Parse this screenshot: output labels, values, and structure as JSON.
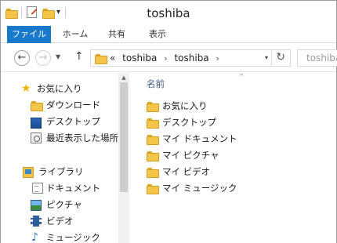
{
  "window": {
    "title": "toshiba"
  },
  "ribbon": {
    "tabs": [
      "ファイル",
      "ホーム",
      "共有",
      "表示"
    ]
  },
  "address": {
    "overflow": "«",
    "crumbs": [
      "toshiba",
      "toshiba"
    ]
  },
  "search": {
    "text": "toshiba"
  },
  "nav": {
    "favorites": {
      "label": "お気に入り",
      "items": [
        "ダウンロード",
        "デスクトップ",
        "最近表示した場所"
      ]
    },
    "libraries": {
      "label": "ライブラリ",
      "items": [
        "ドキュメント",
        "ピクチャ",
        "ビデオ",
        "ミュージック"
      ]
    }
  },
  "content": {
    "column_name": "名前",
    "items": [
      "お気に入り",
      "デスクトップ",
      "マイ ドキュメント",
      "マイ ピクチャ",
      "マイ ビデオ",
      "マイ ミュージック"
    ]
  },
  "colors": {
    "file_tab": "#1979ca",
    "folder": "#f3c548"
  }
}
